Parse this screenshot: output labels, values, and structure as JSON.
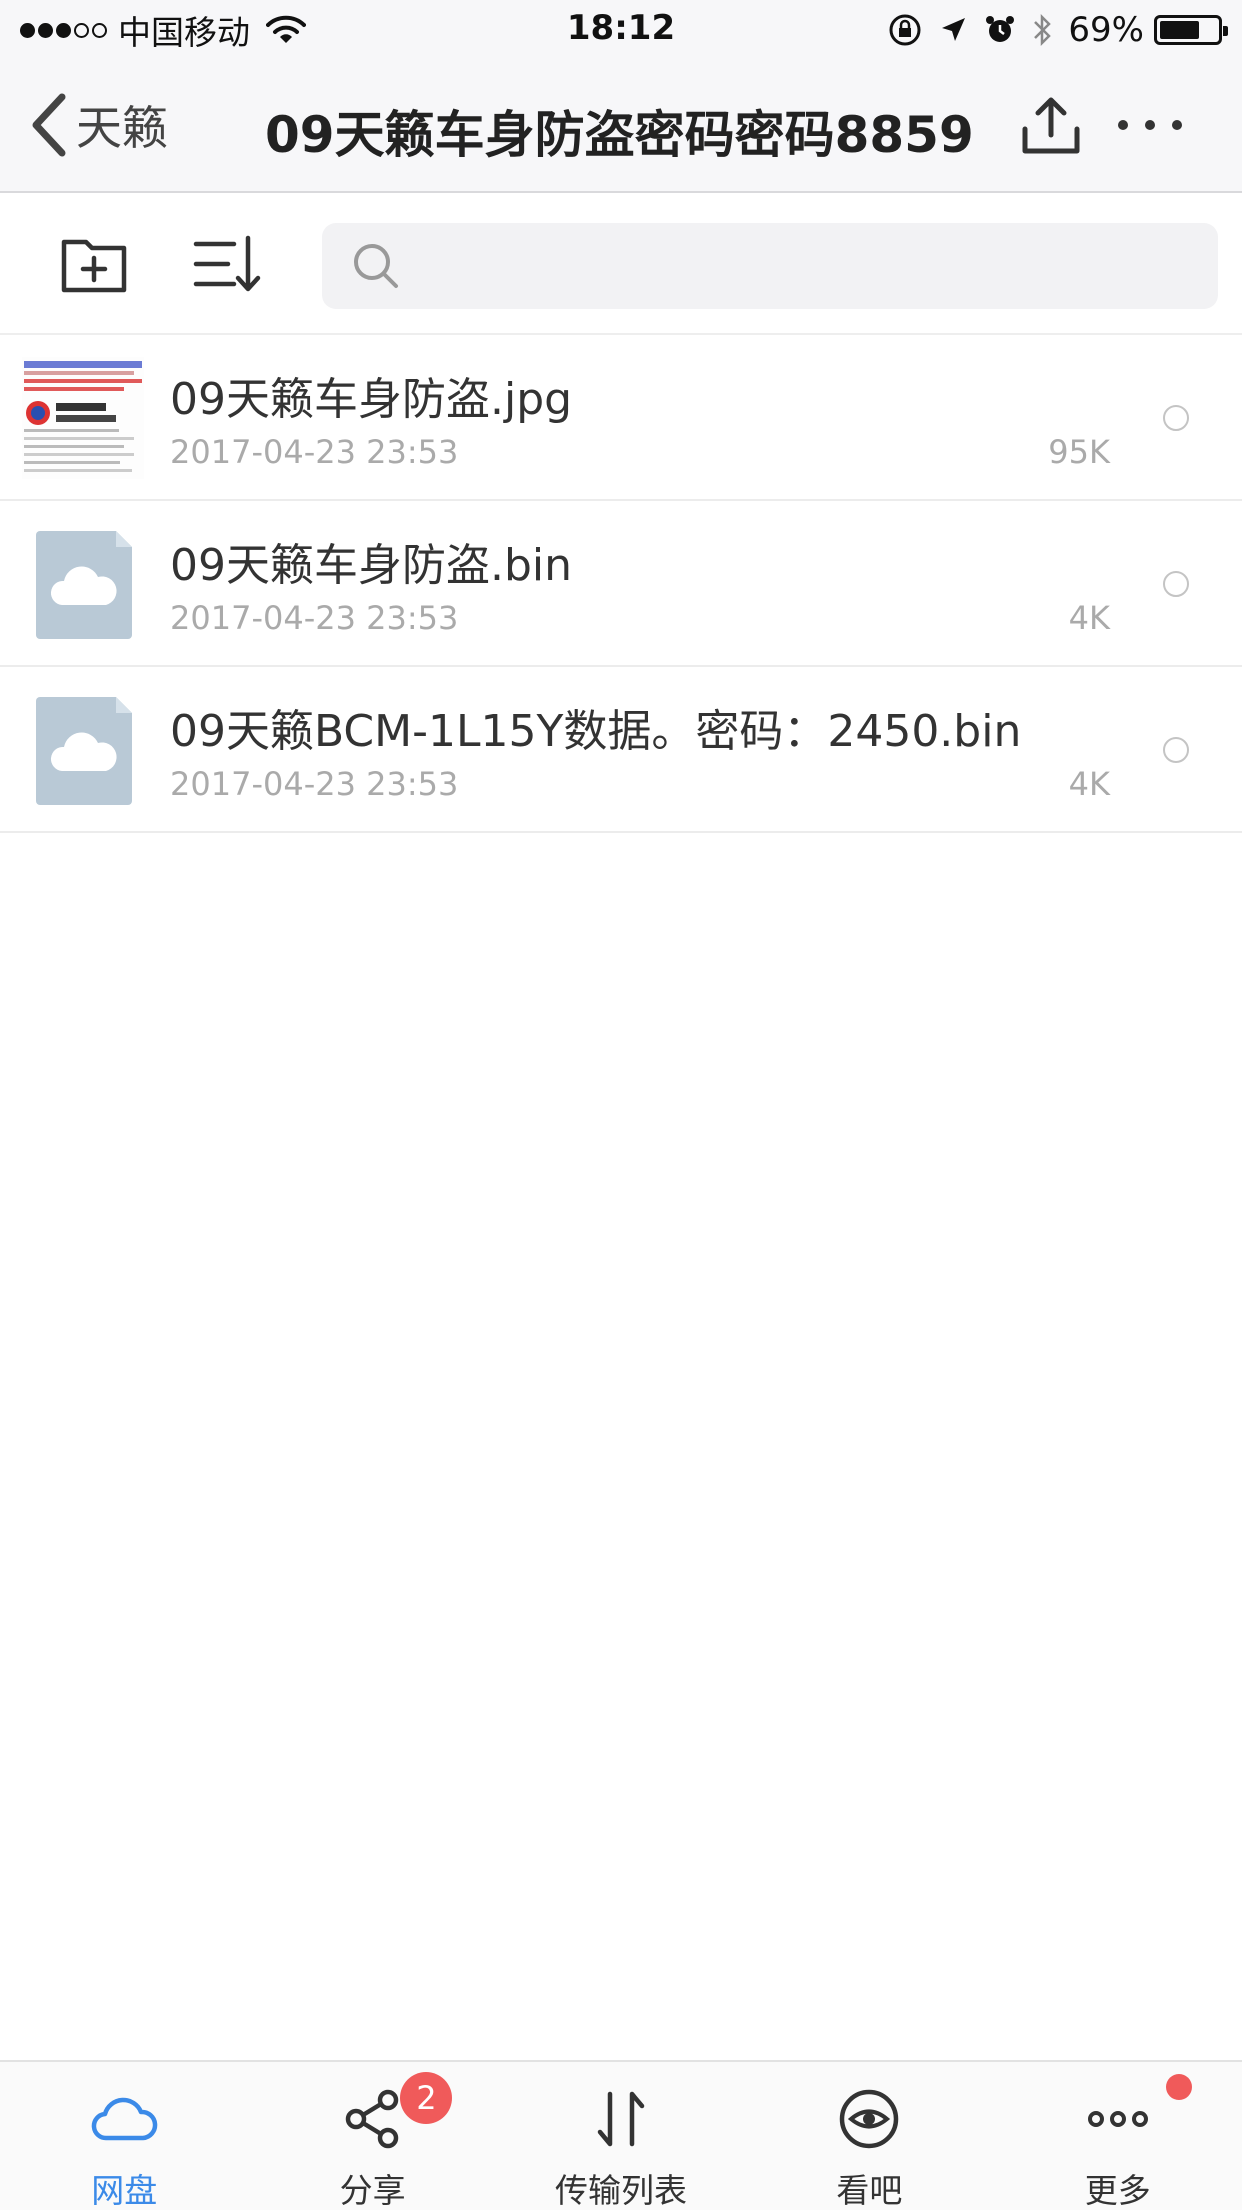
{
  "status_bar": {
    "signal_bars_filled": 3,
    "signal_bars_total": 5,
    "carrier": "中国移动",
    "time": "18:12",
    "battery_percent": "69%",
    "battery_level": 0.69
  },
  "nav": {
    "back_label": "天籁",
    "title": "09天籁车身防盗密码密码8859",
    "icons": [
      "back-chevron-icon",
      "upload-icon",
      "more-dots-icon"
    ]
  },
  "toolbar": {
    "icons": [
      "new-folder-icon",
      "sort-icon",
      "search-icon"
    ],
    "search_placeholder": ""
  },
  "files": [
    {
      "name": "09天籁车身防盗.jpg",
      "date": "2017-04-23 23:53",
      "size": "95K",
      "kind": "image"
    },
    {
      "name": "09天籁车身防盗.bin",
      "date": "2017-04-23 23:53",
      "size": "4K",
      "kind": "cloud-file"
    },
    {
      "name": "09天籁BCM-1L15Y数据。密码：2450.bin",
      "date": "2017-04-23 23:53",
      "size": "4K",
      "kind": "cloud-file"
    }
  ],
  "tabbar": {
    "tabs": [
      {
        "label": "网盘",
        "icon": "cloud-icon",
        "active": true
      },
      {
        "label": "分享",
        "icon": "share-icon",
        "badge": "2"
      },
      {
        "label": "传输列表",
        "icon": "transfer-icon"
      },
      {
        "label": "看吧",
        "icon": "eye-icon"
      },
      {
        "label": "更多",
        "icon": "more-icon",
        "dot": true
      }
    ]
  },
  "colors": {
    "accent": "#3b8ae8",
    "badge": "#f05a5a",
    "file_icon": "#b9c9d6",
    "secondary_text": "#aaaaaa"
  }
}
